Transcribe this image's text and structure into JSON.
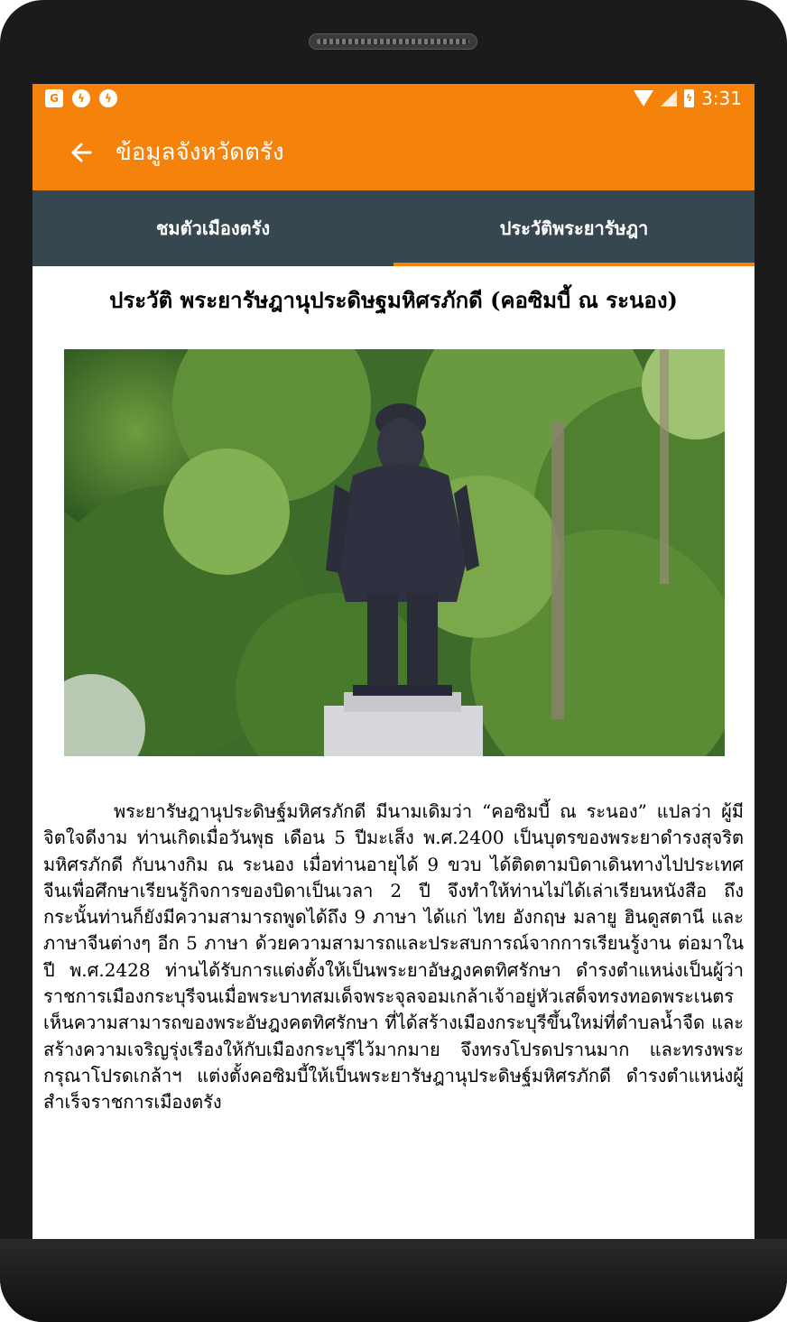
{
  "statusbar": {
    "time": "3:31",
    "left_icons": [
      "gplus-icon",
      "messenger-icon",
      "messenger-icon"
    ],
    "right_icons": [
      "wifi-icon",
      "signal-icon",
      "battery-icon"
    ]
  },
  "toolbar": {
    "title": "ข้อมูลจังหวัดตรัง",
    "back_icon": "arrow-left-icon"
  },
  "tabs": [
    {
      "label": "ชมตัวเมืองตรัง",
      "selected": false
    },
    {
      "label": "ประวัติพระยารัษฎา",
      "selected": true
    }
  ],
  "article": {
    "heading": "ประวัติ พระยารัษฎานุประดิษฐมหิศรภักดี (คอซิมบี้ ณ ระนอง)",
    "body": "พระยารัษฎานุประดิษฐ์มหิศรภักดี มีนามเดิมว่า “คอซิมบี้ ณ ระนอง” แปลว่า ผู้มีจิตใจดีงาม ท่านเกิดเมื่อวันพุธ เดือน 5 ปีมะเส็ง พ.ศ.2400 เป็นบุตรของพระยาดำรงสุจริตมหิศรภักดี กับนางกิม ณ ระนอง เมื่อท่านอายุได้ 9 ขวบ ได้ติดตามบิดาเดินทางไปประเทศจีนเพื่อศึกษาเรียนรู้กิจการของบิดาเป็นเวลา 2 ปี จึงทำให้ท่านไม่ได้เล่าเรียนหนังสือ ถึงกระนั้นท่านก็ยังมีความสามารถพูดได้ถึง 9 ภาษา ได้แก่ ไทย อังกฤษ มลายู ฮินดูสตานี และภาษาจีนต่างๆ อีก 5 ภาษา ด้วยความสามารถและประสบการณ์จากการเรียนรู้งาน ต่อมาในปี พ.ศ.2428 ท่านได้รับการแต่งตั้งให้เป็นพระยาอัษฎงคตทิศรักษา ดำรงตำแหน่งเป็นผู้ว่าราชการเมืองกระบุรีจนเมื่อพระบาทสมเด็จพระจุลจอมเกล้าเจ้าอยู่หัวเสด็จทรงทอดพระเนตรเห็นความสามารถของพระอัษฎงคตทิศรักษา ที่ได้สร้างเมืองกระบุรีขึ้นใหม่ที่ตำบลน้ำจืด และสร้างความเจริญรุ่งเรืองให้กับเมืองกระบุรีไว้มากมาย จึงทรงโปรดปรานมาก และทรงพระกรุณาโปรดเกล้าฯ แต่งตั้งคอซิมบี้ให้เป็นพระยารัษฎานุประดิษฐ์มหิศรภักดี ดำรงตำแหน่งผู้สำเร็จราชการเมืองตรัง"
  },
  "colors": {
    "accent": "#f5830b",
    "tab_bar": "#37474f",
    "text": "#000000"
  }
}
